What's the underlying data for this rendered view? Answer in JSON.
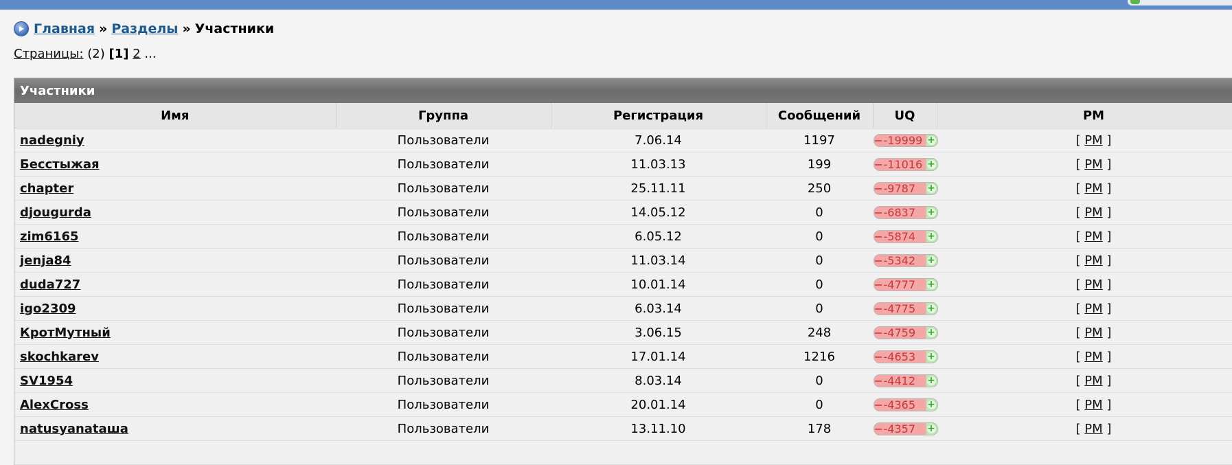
{
  "breadcrumb": {
    "home": "Главная",
    "sep": "»",
    "sections": "Разделы",
    "current": "Участники"
  },
  "pagination": {
    "label": "Страницы:",
    "total": "(2)",
    "current": "[1]",
    "next": "2",
    "more": "..."
  },
  "panel": {
    "title": "Участники"
  },
  "table": {
    "headers": {
      "name": "Имя",
      "group": "Группа",
      "registered": "Регистрация",
      "posts": "Сообщений",
      "uq": "UQ",
      "pm": "PM"
    },
    "uq_minus": "−",
    "uq_plus": "+",
    "pm_open": "[",
    "pm_link": "PM",
    "pm_close": "]",
    "rows": [
      {
        "name": "nadegniy",
        "group": "Пользователи",
        "registered": "7.06.14",
        "posts": "1197",
        "uq": "-19999"
      },
      {
        "name": "Бесстыжая",
        "group": "Пользователи",
        "registered": "11.03.13",
        "posts": "199",
        "uq": "-11016"
      },
      {
        "name": "chapter",
        "group": "Пользователи",
        "registered": "25.11.11",
        "posts": "250",
        "uq": "-9787"
      },
      {
        "name": "djougurda",
        "group": "Пользователи",
        "registered": "14.05.12",
        "posts": "0",
        "uq": "-6837"
      },
      {
        "name": "zim6165",
        "group": "Пользователи",
        "registered": "6.05.12",
        "posts": "0",
        "uq": "-5874"
      },
      {
        "name": "jenja84",
        "group": "Пользователи",
        "registered": "11.03.14",
        "posts": "0",
        "uq": "-5342"
      },
      {
        "name": "duda727",
        "group": "Пользователи",
        "registered": "10.01.14",
        "posts": "0",
        "uq": "-4777"
      },
      {
        "name": "igo2309",
        "group": "Пользователи",
        "registered": "6.03.14",
        "posts": "0",
        "uq": "-4775"
      },
      {
        "name": "КротМутный",
        "group": "Пользователи",
        "registered": "3.06.15",
        "posts": "248",
        "uq": "-4759"
      },
      {
        "name": "skochkarev",
        "group": "Пользователи",
        "registered": "17.01.14",
        "posts": "1216",
        "uq": "-4653"
      },
      {
        "name": "SV1954",
        "group": "Пользователи",
        "registered": "8.03.14",
        "posts": "0",
        "uq": "-4412"
      },
      {
        "name": "AlexCross",
        "group": "Пользователи",
        "registered": "20.01.14",
        "posts": "0",
        "uq": "-4365"
      },
      {
        "name": "natusyanataша",
        "group": "Пользователи",
        "registered": "13.11.10",
        "posts": "178",
        "uq": "-4357"
      },
      {
        "name": "",
        "group": "",
        "registered": "",
        "posts": "",
        "uq": ""
      }
    ]
  },
  "colors": {
    "topbar": "#5f8ac9",
    "link": "#1f5a8e",
    "panel_header": "#777777",
    "uq_negative": "#f3a7a7",
    "uq_positive": "#b9e6b2"
  }
}
